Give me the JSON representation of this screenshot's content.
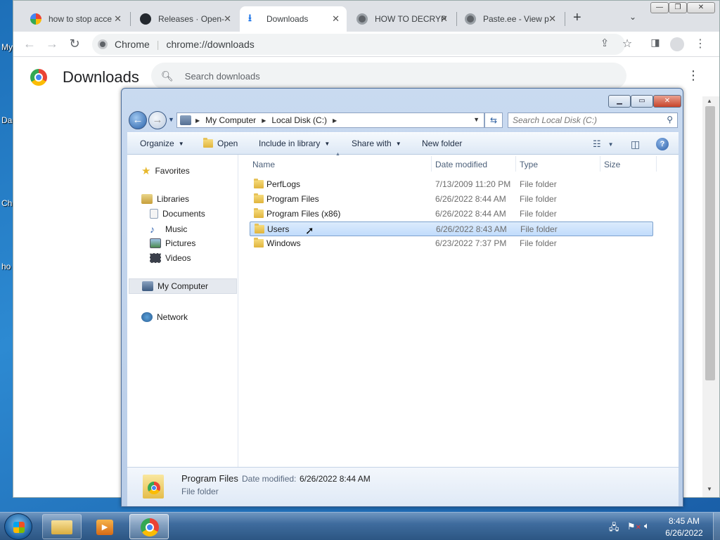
{
  "desktop": {
    "labels": [
      "My",
      "Da",
      "Ch",
      "ho"
    ]
  },
  "chrome": {
    "tabs": [
      {
        "title": "how to stop acce",
        "icon": "google-icon",
        "active": false
      },
      {
        "title": "Releases · Open-",
        "icon": "github-icon",
        "active": false
      },
      {
        "title": "Downloads",
        "icon": "download-icon",
        "active": true
      },
      {
        "title": "HOW TO DECRYP",
        "icon": "globe-icon",
        "active": false
      },
      {
        "title": "Paste.ee - View p",
        "icon": "globe-icon",
        "active": false
      }
    ],
    "new_tab_label": "+",
    "omnibox": {
      "site": "Chrome",
      "url": "chrome://downloads"
    },
    "accent": "#1a73e8"
  },
  "downloads": {
    "title": "Downloads",
    "search_placeholder": "Search downloads"
  },
  "explorer": {
    "breadcrumb": [
      "My Computer",
      "Local Disk (C:)"
    ],
    "search_placeholder": "Search Local Disk (C:)",
    "commands": {
      "organize": "Organize",
      "open": "Open",
      "include_in_library": "Include in library",
      "share_with": "Share with",
      "new_folder": "New folder"
    },
    "nav": {
      "favorites": "Favorites",
      "libraries": "Libraries",
      "documents": "Documents",
      "music": "Music",
      "pictures": "Pictures",
      "videos": "Videos",
      "my_computer": "My Computer",
      "network": "Network"
    },
    "columns": {
      "name": "Name",
      "date_modified": "Date modified",
      "type": "Type",
      "size": "Size"
    },
    "files": [
      {
        "name": "PerfLogs",
        "date": "7/13/2009 11:20 PM",
        "type": "File folder",
        "selected": false
      },
      {
        "name": "Program Files",
        "date": "6/26/2022 8:44 AM",
        "type": "File folder",
        "selected": false
      },
      {
        "name": "Program Files (x86)",
        "date": "6/26/2022 8:44 AM",
        "type": "File folder",
        "selected": false
      },
      {
        "name": "Users",
        "date": "6/26/2022 8:43 AM",
        "type": "File folder",
        "selected": true
      },
      {
        "name": "Windows",
        "date": "6/23/2022 7:37 PM",
        "type": "File folder",
        "selected": false
      }
    ],
    "details": {
      "name": "Program Files",
      "date_label": "Date modified:",
      "date_value": "6/26/2022 8:44 AM",
      "type": "File folder"
    }
  },
  "taskbar": {
    "time": "8:45 AM",
    "date": "6/26/2022"
  }
}
